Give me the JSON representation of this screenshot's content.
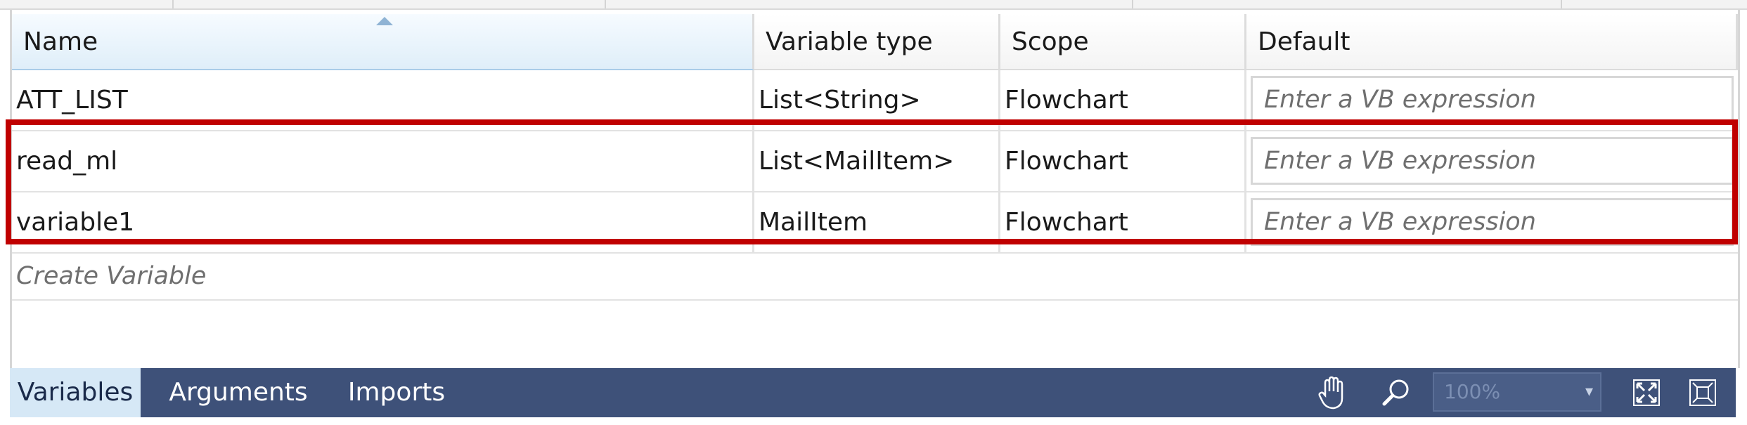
{
  "grid": {
    "columns": [
      {
        "label": "Name",
        "sorted": "ascending"
      },
      {
        "label": "Variable type"
      },
      {
        "label": "Scope"
      },
      {
        "label": "Default"
      }
    ],
    "rows": [
      {
        "name": "ATT_LIST",
        "type": "List<String>",
        "scope": "Flowchart",
        "default_placeholder": "Enter a VB expression"
      },
      {
        "name": "read_ml",
        "type": "List<MailItem>",
        "scope": "Flowchart",
        "default_placeholder": "Enter a VB expression"
      },
      {
        "name": "variable1",
        "type": "MailItem",
        "scope": "Flowchart",
        "default_placeholder": "Enter a VB expression"
      }
    ],
    "create_label": "Create Variable",
    "highlight_color": "#c00000"
  },
  "bottom_bar": {
    "tabs": [
      {
        "label": "Variables",
        "active": true
      },
      {
        "label": "Arguments"
      },
      {
        "label": "Imports"
      }
    ],
    "icons": [
      "pan-hand-icon",
      "zoom-magnifier-icon",
      "fit-to-screen-icon",
      "overview-icon"
    ],
    "zoom_value": "100%",
    "background": "#3e5179"
  }
}
